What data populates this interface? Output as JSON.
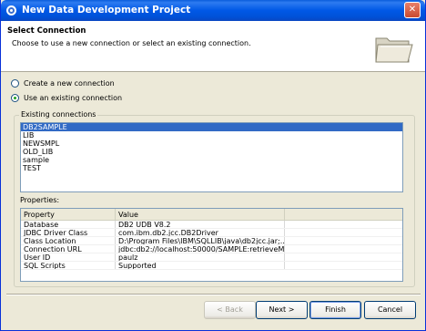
{
  "window": {
    "title": "New Data Development Project",
    "close_label": "✕"
  },
  "header": {
    "title": "Select Connection",
    "description": "Choose to use a new connection or select an existing connection."
  },
  "options": {
    "new_connection_label": "Create a new connection",
    "existing_connection_label": "Use an existing connection",
    "selected": "existing"
  },
  "existing_connections": {
    "legend": "Existing connections",
    "items": [
      "DB2SAMPLE",
      "LIB",
      "NEWSMPL",
      "OLD_LIB",
      "sample",
      "TEST"
    ],
    "selected_index": 0
  },
  "properties": {
    "label": "Properties:",
    "headers": [
      "Property",
      "Value",
      ""
    ],
    "rows": [
      [
        "Database",
        "DB2 UDB V8.2"
      ],
      [
        "JDBC Driver Class",
        "com.ibm.db2.jcc.DB2Driver"
      ],
      [
        "Class Location",
        "D:\\Program Files\\IBM\\SQLLIB\\java\\db2jcc.jar;..."
      ],
      [
        "Connection URL",
        "jdbc:db2://localhost:50000/SAMPLE:retrieveM..."
      ],
      [
        "User ID",
        "paulz"
      ],
      [
        "SQL Scripts",
        "Supported"
      ]
    ]
  },
  "buttons": {
    "back": "< Back",
    "next": "Next >",
    "finish": "Finish",
    "cancel": "Cancel"
  },
  "colors": {
    "titlebar": "#0058e6",
    "selection": "#316ac5",
    "dialog_bg": "#ece9d8"
  }
}
